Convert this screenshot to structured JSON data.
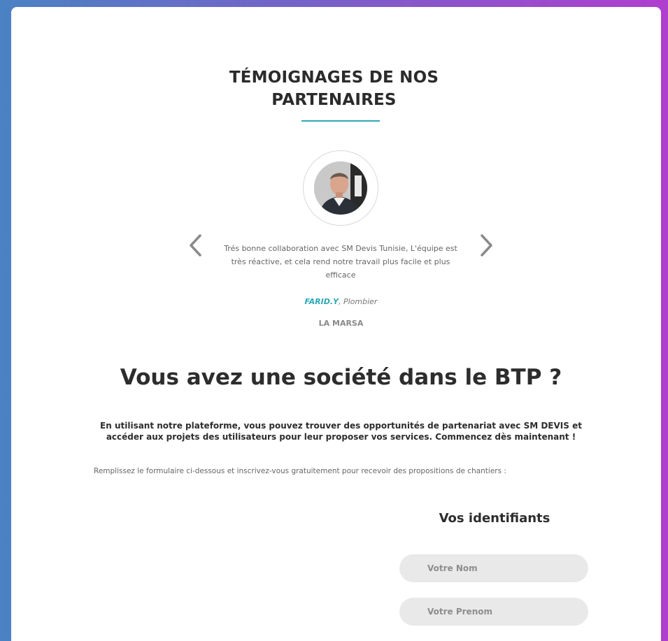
{
  "testimonials": {
    "title_line1": "TÉMOIGNAGES DE NOS",
    "title_line2": "PARTENAIRES",
    "quote": "Trés bonne collaboration avec SM Devis Tunisie, L'équipe est très réactive, et cela rend notre travail plus facile et plus efficace",
    "author_name": "FARID.Y",
    "author_role": ", Plombier",
    "city": "LA MARSA",
    "prev_icon": "chevron-left-icon",
    "next_icon": "chevron-right-icon",
    "accent_color": "#2aa7b5"
  },
  "partner_section": {
    "headline": "Vous avez une société dans le BTP ?",
    "lead": "En utilisant notre plateforme, vous pouvez trouver des opportunités de partenariat avec SM DEVIS et accéder aux projets des utilisateurs pour leur proposer vos services. Commencez dès maintenant !",
    "instruction": "Remplissez le formulaire ci-dessous et inscrivez-vous gratuitement pour recevoir des propositions de chantiers :"
  },
  "form": {
    "title": "Vos identifiants",
    "nom_placeholder": "Votre Nom",
    "prenom_placeholder": "Votre Prenom"
  }
}
